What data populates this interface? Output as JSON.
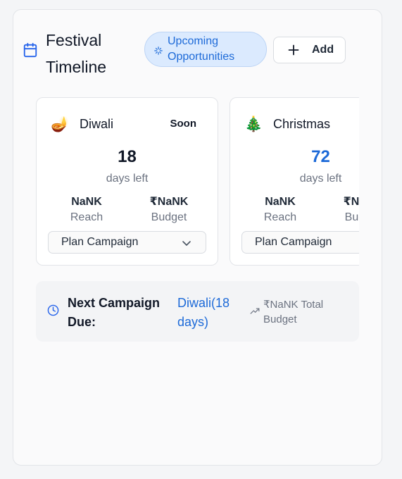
{
  "header": {
    "title": "Festival Timeline",
    "badge": "Upcoming Opportunities",
    "add_label": "Add",
    "icons": {
      "calendar": "calendar-icon",
      "badge": "sparkle-icon",
      "add": "plus-icon"
    }
  },
  "festivals": [
    {
      "emoji": "🪔",
      "name": "Diwali",
      "status": "Soon",
      "days": "18",
      "days_label": "days left",
      "days_color": "#111827",
      "reach_value": "NaNK",
      "reach_label": "Reach",
      "budget_value": "₹NaNK",
      "budget_label": "Budget",
      "plan_label": "Plan Campaign"
    },
    {
      "emoji": "🎄",
      "name": "Christmas",
      "status": "",
      "days": "72",
      "days_label": "days left",
      "days_color": "#1d6ad8",
      "reach_value": "NaNK",
      "reach_label": "Reach",
      "budget_value": "₹NaNK",
      "budget_label": "Budget",
      "plan_label": "Plan Campaign"
    }
  ],
  "next_campaign": {
    "label": "Next Campaign Due:",
    "value": "Diwali(18 days)",
    "budget_text": "₹NaNK Total Budget",
    "icons": {
      "clock": "clock-icon",
      "trend": "trending-up-icon"
    }
  },
  "colors": {
    "accent": "#1d6ad8",
    "badge_bg": "#dbeafe",
    "muted": "#6b7280"
  }
}
